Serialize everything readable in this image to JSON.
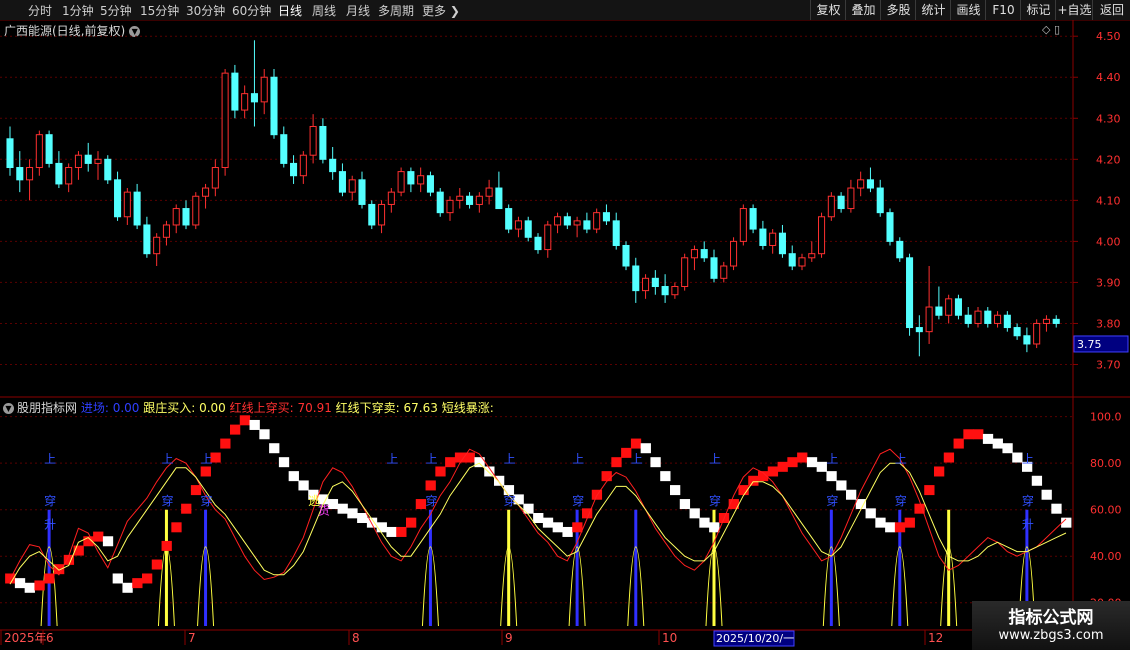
{
  "toolbar": {
    "periods": [
      "分时",
      "1分钟",
      "5分钟",
      "15分钟",
      "30分钟",
      "60分钟",
      "日线",
      "周线",
      "月线",
      "多周期",
      "更多"
    ],
    "active_period": "日线",
    "right_buttons": [
      "复权",
      "叠加",
      "多股",
      "统计",
      "画线",
      "F10",
      "标记",
      "+自选",
      "返回"
    ]
  },
  "main": {
    "title": "广西能源(日线,前复权)",
    "current_price": "3.75",
    "y_ticks": [
      "4.50",
      "4.40",
      "4.30",
      "4.20",
      "4.10",
      "4.00",
      "3.90",
      "3.80",
      "3.70"
    ],
    "colors": {
      "up": "#ff3030",
      "down": "#54ffff",
      "grid": "#5a0000"
    }
  },
  "indicator": {
    "name": "股朋指标网",
    "legend": [
      {
        "text": "进场: 0.00",
        "color": "#2f3fff"
      },
      {
        "text": "跟庄买入: 0.00",
        "color": "#ffff66"
      },
      {
        "text": "红线上穿买: 70.91",
        "color": "#ff3030"
      },
      {
        "text": "红线下穿卖: 67.63",
        "color": "#ffff66"
      },
      {
        "text": "短线暴涨:",
        "color": "#ffff66"
      }
    ],
    "y_ticks": [
      "100.0",
      "80.00",
      "60.00",
      "40.00",
      "20.00"
    ],
    "signal_labels": [
      "上",
      "穿",
      "升",
      "趋",
      "逃",
      "货"
    ]
  },
  "x_axis": {
    "labels": [
      "2025年",
      "6",
      "7",
      "8",
      "9",
      "10",
      "12"
    ],
    "cursor_date": "2025/10/20/一"
  },
  "watermark": {
    "line1": "指标公式网",
    "line2": "www.zbgs3.com"
  },
  "chart_data": {
    "type": "candlestick",
    "price_range": [
      3.65,
      4.52
    ],
    "ohlc": [
      [
        4.25,
        4.28,
        4.16,
        4.18
      ],
      [
        4.18,
        4.22,
        4.12,
        4.15
      ],
      [
        4.15,
        4.2,
        4.1,
        4.18
      ],
      [
        4.18,
        4.27,
        4.16,
        4.26
      ],
      [
        4.26,
        4.27,
        4.18,
        4.19
      ],
      [
        4.19,
        4.22,
        4.13,
        4.14
      ],
      [
        4.14,
        4.19,
        4.12,
        4.18
      ],
      [
        4.18,
        4.22,
        4.15,
        4.21
      ],
      [
        4.21,
        4.24,
        4.17,
        4.19
      ],
      [
        4.19,
        4.22,
        4.15,
        4.2
      ],
      [
        4.2,
        4.21,
        4.14,
        4.15
      ],
      [
        4.15,
        4.17,
        4.05,
        4.06
      ],
      [
        4.06,
        4.13,
        4.04,
        4.12
      ],
      [
        4.12,
        4.14,
        4.03,
        4.04
      ],
      [
        4.04,
        4.06,
        3.96,
        3.97
      ],
      [
        3.97,
        4.02,
        3.94,
        4.01
      ],
      [
        4.01,
        4.05,
        3.99,
        4.04
      ],
      [
        4.04,
        4.09,
        4.02,
        4.08
      ],
      [
        4.08,
        4.1,
        4.03,
        4.04
      ],
      [
        4.04,
        4.12,
        4.03,
        4.11
      ],
      [
        4.11,
        4.14,
        4.08,
        4.13
      ],
      [
        4.13,
        4.2,
        4.11,
        4.18
      ],
      [
        4.18,
        4.42,
        4.16,
        4.41
      ],
      [
        4.41,
        4.43,
        4.3,
        4.32
      ],
      [
        4.32,
        4.38,
        4.3,
        4.36
      ],
      [
        4.36,
        4.49,
        4.28,
        4.34
      ],
      [
        4.34,
        4.42,
        4.31,
        4.4
      ],
      [
        4.4,
        4.42,
        4.25,
        4.26
      ],
      [
        4.26,
        4.28,
        4.18,
        4.19
      ],
      [
        4.19,
        4.21,
        4.14,
        4.16
      ],
      [
        4.16,
        4.22,
        4.14,
        4.21
      ],
      [
        4.21,
        4.31,
        4.19,
        4.28
      ],
      [
        4.28,
        4.3,
        4.19,
        4.2
      ],
      [
        4.2,
        4.23,
        4.15,
        4.17
      ],
      [
        4.17,
        4.19,
        4.11,
        4.12
      ],
      [
        4.12,
        4.16,
        4.1,
        4.15
      ],
      [
        4.15,
        4.17,
        4.08,
        4.09
      ],
      [
        4.09,
        4.1,
        4.03,
        4.04
      ],
      [
        4.04,
        4.1,
        4.02,
        4.09
      ],
      [
        4.09,
        4.13,
        4.07,
        4.12
      ],
      [
        4.12,
        4.18,
        4.11,
        4.17
      ],
      [
        4.17,
        4.18,
        4.12,
        4.14
      ],
      [
        4.14,
        4.18,
        4.12,
        4.16
      ],
      [
        4.16,
        4.17,
        4.11,
        4.12
      ],
      [
        4.12,
        4.13,
        4.06,
        4.07
      ],
      [
        4.07,
        4.11,
        4.05,
        4.1
      ],
      [
        4.1,
        4.13,
        4.08,
        4.11
      ],
      [
        4.11,
        4.12,
        4.08,
        4.09
      ],
      [
        4.09,
        4.12,
        4.07,
        4.11
      ],
      [
        4.11,
        4.15,
        4.09,
        4.13
      ],
      [
        4.13,
        4.17,
        4.11,
        4.08
      ],
      [
        4.08,
        4.09,
        4.02,
        4.03
      ],
      [
        4.03,
        4.06,
        4.01,
        4.05
      ],
      [
        4.05,
        4.06,
        4.0,
        4.01
      ],
      [
        4.01,
        4.02,
        3.97,
        3.98
      ],
      [
        3.98,
        4.05,
        3.96,
        4.04
      ],
      [
        4.04,
        4.07,
        4.02,
        4.06
      ],
      [
        4.06,
        4.07,
        4.03,
        4.04
      ],
      [
        4.04,
        4.06,
        4.01,
        4.05
      ],
      [
        4.05,
        4.07,
        4.02,
        4.03
      ],
      [
        4.03,
        4.08,
        4.02,
        4.07
      ],
      [
        4.07,
        4.09,
        4.04,
        4.05
      ],
      [
        4.05,
        4.07,
        3.98,
        3.99
      ],
      [
        3.99,
        4.0,
        3.93,
        3.94
      ],
      [
        3.94,
        3.96,
        3.85,
        3.88
      ],
      [
        3.88,
        3.92,
        3.86,
        3.91
      ],
      [
        3.91,
        3.93,
        3.87,
        3.89
      ],
      [
        3.89,
        3.92,
        3.85,
        3.87
      ],
      [
        3.87,
        3.9,
        3.86,
        3.89
      ],
      [
        3.89,
        3.97,
        3.88,
        3.96
      ],
      [
        3.96,
        3.99,
        3.93,
        3.98
      ],
      [
        3.98,
        4.0,
        3.95,
        3.96
      ],
      [
        3.96,
        3.98,
        3.9,
        3.91
      ],
      [
        3.91,
        3.95,
        3.9,
        3.94
      ],
      [
        3.94,
        4.01,
        3.93,
        4.0
      ],
      [
        4.0,
        4.09,
        3.99,
        4.08
      ],
      [
        4.08,
        4.09,
        4.02,
        4.03
      ],
      [
        4.03,
        4.05,
        3.98,
        3.99
      ],
      [
        3.99,
        4.03,
        3.97,
        4.02
      ],
      [
        4.02,
        4.04,
        3.96,
        3.97
      ],
      [
        3.97,
        3.99,
        3.93,
        3.94
      ],
      [
        3.94,
        3.97,
        3.93,
        3.96
      ],
      [
        3.96,
        4.0,
        3.95,
        3.97
      ],
      [
        3.97,
        4.07,
        3.96,
        4.06
      ],
      [
        4.06,
        4.12,
        4.05,
        4.11
      ],
      [
        4.11,
        4.12,
        4.07,
        4.08
      ],
      [
        4.08,
        4.15,
        4.07,
        4.13
      ],
      [
        4.13,
        4.17,
        4.11,
        4.15
      ],
      [
        4.15,
        4.18,
        4.12,
        4.13
      ],
      [
        4.13,
        4.15,
        4.06,
        4.07
      ],
      [
        4.07,
        4.08,
        3.99,
        4.0
      ],
      [
        4.0,
        4.01,
        3.95,
        3.96
      ],
      [
        3.96,
        3.97,
        3.77,
        3.79
      ],
      [
        3.79,
        3.82,
        3.72,
        3.78
      ],
      [
        3.78,
        3.94,
        3.75,
        3.84
      ],
      [
        3.84,
        3.89,
        3.81,
        3.82
      ],
      [
        3.82,
        3.87,
        3.8,
        3.86
      ],
      [
        3.86,
        3.87,
        3.81,
        3.82
      ],
      [
        3.82,
        3.84,
        3.79,
        3.8
      ],
      [
        3.8,
        3.84,
        3.79,
        3.83
      ],
      [
        3.83,
        3.84,
        3.79,
        3.8
      ],
      [
        3.8,
        3.83,
        3.79,
        3.82
      ],
      [
        3.82,
        3.83,
        3.78,
        3.79
      ],
      [
        3.79,
        3.8,
        3.76,
        3.77
      ],
      [
        3.77,
        3.79,
        3.73,
        3.75
      ],
      [
        3.75,
        3.81,
        3.74,
        3.8
      ],
      [
        3.8,
        3.82,
        3.78,
        3.81
      ],
      [
        3.81,
        3.82,
        3.79,
        3.8
      ]
    ],
    "indicator_range": [
      10,
      102
    ],
    "red_line": [
      30,
      38,
      45,
      44,
      36,
      32,
      40,
      52,
      50,
      42,
      35,
      45,
      55,
      60,
      65,
      72,
      78,
      82,
      80,
      74,
      66,
      60,
      56,
      48,
      40,
      34,
      30,
      31,
      33,
      40,
      48,
      60,
      72,
      78,
      76,
      70,
      62,
      54,
      46,
      40,
      38,
      44,
      52,
      58,
      66,
      72,
      80,
      86,
      84,
      78,
      72,
      66,
      62,
      56,
      50,
      46,
      40,
      38,
      46,
      56,
      66,
      72,
      76,
      74,
      68,
      60,
      52,
      46,
      40,
      36,
      34,
      38,
      46,
      56,
      66,
      74,
      78,
      76,
      72,
      66,
      58,
      50,
      44,
      38,
      40,
      48,
      58,
      68,
      76,
      84,
      86,
      82,
      74,
      64,
      52,
      40,
      34,
      36,
      40,
      44,
      48,
      46,
      42,
      40,
      42,
      44,
      48,
      52,
      56
    ],
    "yellow_line": [
      28,
      35,
      40,
      42,
      38,
      34,
      36,
      46,
      48,
      44,
      38,
      40,
      48,
      54,
      60,
      66,
      72,
      78,
      78,
      74,
      68,
      62,
      58,
      52,
      46,
      40,
      34,
      32,
      32,
      36,
      42,
      52,
      62,
      70,
      72,
      68,
      62,
      56,
      50,
      44,
      40,
      40,
      46,
      52,
      58,
      66,
      72,
      78,
      80,
      76,
      72,
      66,
      62,
      58,
      52,
      48,
      44,
      40,
      42,
      50,
      58,
      64,
      70,
      70,
      66,
      60,
      54,
      48,
      44,
      40,
      38,
      38,
      42,
      50,
      58,
      66,
      72,
      72,
      70,
      66,
      60,
      54,
      48,
      42,
      40,
      44,
      52,
      60,
      68,
      76,
      80,
      80,
      76,
      68,
      58,
      48,
      40,
      38,
      38,
      40,
      44,
      46,
      44,
      42,
      42,
      44,
      46,
      48,
      50
    ],
    "staircase": [
      30,
      28,
      26,
      27,
      30,
      34,
      38,
      42,
      46,
      48,
      46,
      30,
      26,
      28,
      30,
      36,
      44,
      52,
      60,
      68,
      76,
      82,
      88,
      94,
      98,
      96,
      92,
      86,
      80,
      74,
      70,
      66,
      64,
      62,
      60,
      58,
      56,
      54,
      52,
      50,
      50,
      54,
      62,
      70,
      76,
      80,
      82,
      82,
      80,
      76,
      72,
      68,
      64,
      60,
      56,
      54,
      52,
      50,
      52,
      58,
      66,
      74,
      80,
      84,
      88,
      86,
      80,
      74,
      68,
      62,
      58,
      54,
      52,
      56,
      62,
      68,
      72,
      74,
      76,
      78,
      80,
      82,
      80,
      78,
      74,
      70,
      66,
      62,
      58,
      54,
      52,
      52,
      54,
      60,
      68,
      76,
      82,
      88,
      92,
      92,
      90,
      88,
      86,
      82,
      78,
      72,
      66,
      60,
      54
    ]
  }
}
